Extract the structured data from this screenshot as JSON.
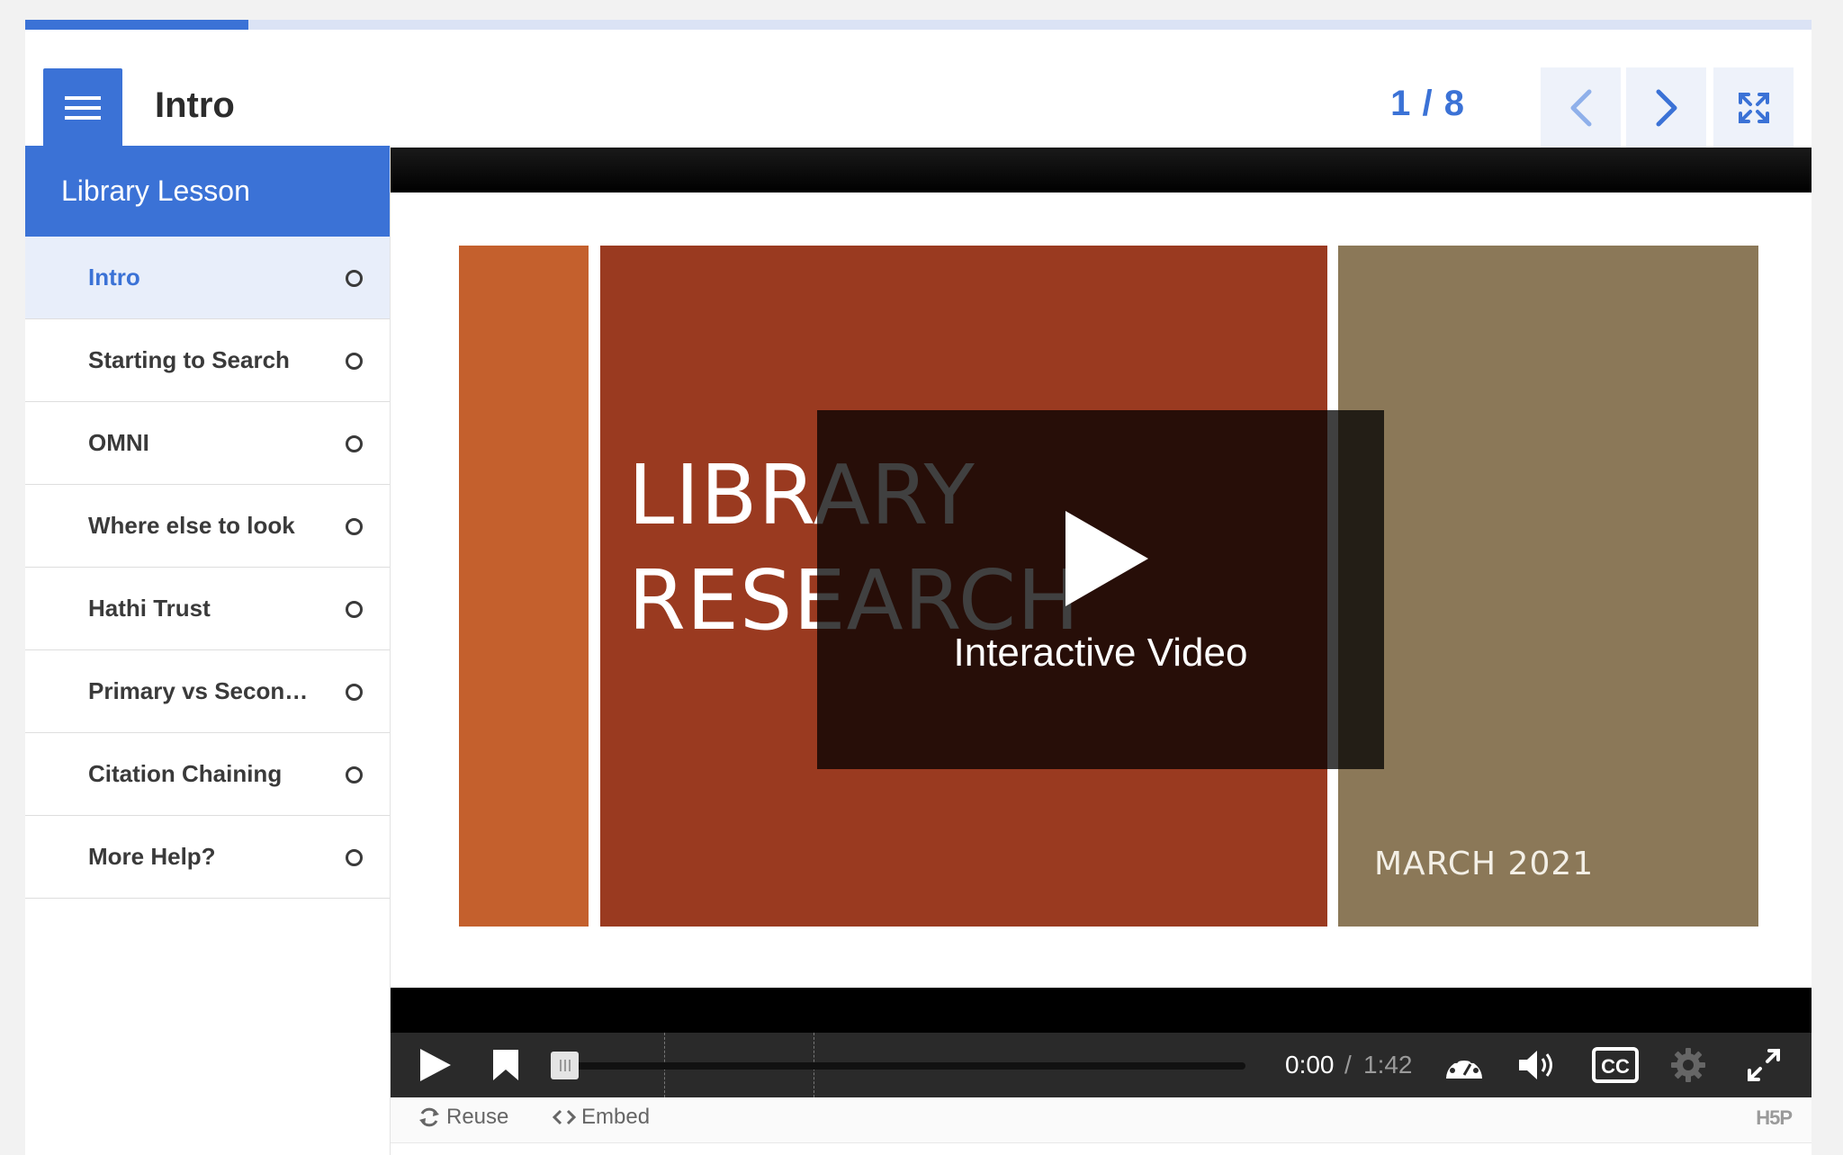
{
  "colors": {
    "accent": "#3b72d6",
    "slide_orange": "#c4602d",
    "slide_red": "#9a3a20",
    "slide_brown": "#8b7858"
  },
  "progress": {
    "fraction": 0.125
  },
  "header": {
    "title": "Intro",
    "page_counter": "1 / 8",
    "menu_icon": "hamburger-icon",
    "prev_icon": "chevron-left-icon",
    "next_icon": "chevron-right-icon",
    "fullscreen_icon": "fullscreen-icon"
  },
  "sidebar": {
    "title": "Library Lesson",
    "items": [
      {
        "label": "Intro"
      },
      {
        "label": "Starting to Search"
      },
      {
        "label": "OMNI"
      },
      {
        "label": "Where else to look"
      },
      {
        "label": "Hathi Trust"
      },
      {
        "label": "Primary vs Secondary Sources"
      },
      {
        "label": "Citation Chaining"
      },
      {
        "label": "More Help?"
      }
    ]
  },
  "video": {
    "slide_line1": "LIBRARY",
    "slide_line2": "RESEARCH",
    "slide_date": "MARCH 2021",
    "overlay_label": "Interactive Video",
    "time_current": "0:00",
    "time_separator": "/",
    "time_total": "1:42",
    "seek_fraction": 0.0
  },
  "footer": {
    "reuse_label": "Reuse",
    "embed_label": "Embed",
    "logo_text": "H5P"
  }
}
